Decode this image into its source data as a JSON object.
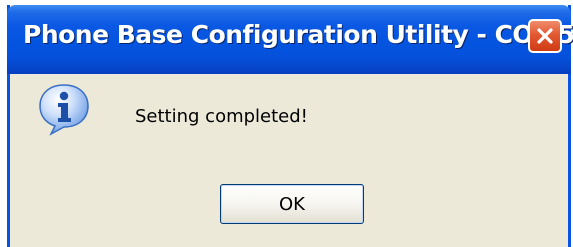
{
  "dialog": {
    "title": "Phone Base Configuration Utility - COM5",
    "message": "Setting completed!",
    "ok_label": "OK",
    "icon": "information-icon",
    "close_icon": "close-icon"
  },
  "colors": {
    "titlebar": "#0454e0",
    "client": "#ece9d8",
    "close_button": "#e25a32"
  }
}
